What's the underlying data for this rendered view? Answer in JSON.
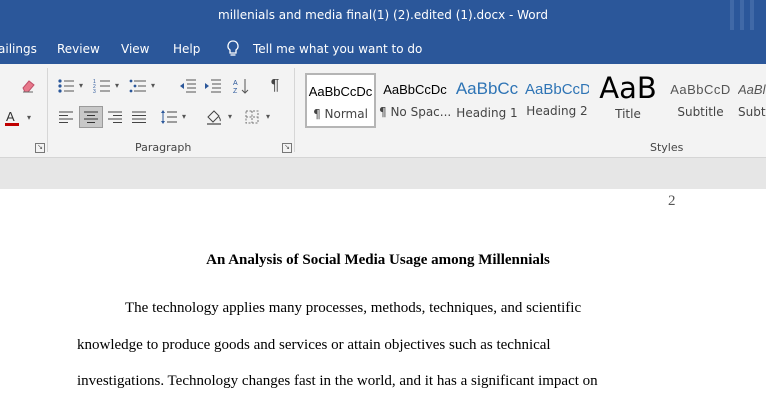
{
  "title_bar": {
    "title": "millenials and media final(1) (2).edited (1).docx  -  Word"
  },
  "menu": {
    "items": [
      "ailings",
      "Review",
      "View",
      "Help"
    ],
    "tell_me": "Tell me what you want to do"
  },
  "ribbon": {
    "paragraph_label": "Paragraph",
    "styles_label": "Styles",
    "styles": [
      {
        "sample": "AaBbCcDc",
        "name": "¶ Normal"
      },
      {
        "sample": "AaBbCcDc",
        "name": "¶ No Spac..."
      },
      {
        "sample": "AaBbCc",
        "name": "Heading 1"
      },
      {
        "sample": "AaBbCcD",
        "name": "Heading 2"
      },
      {
        "sample": "AaB",
        "name": "Title"
      },
      {
        "sample": "AaBbCcD",
        "name": "Subtitle"
      },
      {
        "sample": "AaBl",
        "name": "Subtl"
      }
    ],
    "font_color": "#c00000",
    "heading_color": "#2e74b5"
  },
  "document": {
    "page_number": "2",
    "heading": "An Analysis of Social Media Usage among Millennials",
    "lines": [
      "The technology applies many processes, methods, techniques, and scientific",
      "knowledge to produce goods and services or attain objectives such as technical",
      "investigations. Technology changes fast in the world, and it has a significant impact on"
    ]
  },
  "icons": [
    "eraser-icon",
    "bullets-icon",
    "numbering-icon",
    "multilevel-list-icon",
    "decrease-indent-icon",
    "increase-indent-icon",
    "sort-icon",
    "pilcrow-icon",
    "font-color-icon",
    "align-left-icon",
    "align-center-icon",
    "align-right-icon",
    "justify-icon",
    "line-spacing-icon",
    "shading-icon",
    "borders-icon",
    "lightbulb-icon"
  ]
}
